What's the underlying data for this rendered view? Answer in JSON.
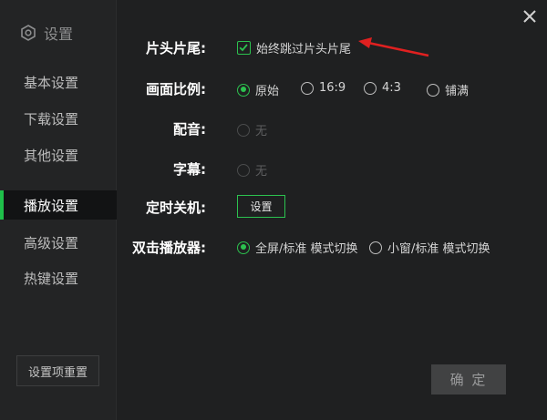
{
  "sidebar": {
    "header": "设置",
    "items": [
      {
        "label": "基本设置"
      },
      {
        "label": "下载设置"
      },
      {
        "label": "其他设置"
      },
      {
        "label": "播放设置"
      },
      {
        "label": "高级设置"
      },
      {
        "label": "热键设置"
      }
    ],
    "active_index": 3,
    "reset_label": "设置项重置"
  },
  "settings": {
    "skip": {
      "label": "片头片尾:",
      "checkbox_label": "始终跳过片头片尾",
      "checked": true
    },
    "aspect": {
      "label": "画面比例:",
      "options": [
        "原始",
        "16:9",
        "4:3",
        "铺满"
      ],
      "selected": "原始"
    },
    "dubbing": {
      "label": "配音:",
      "option": "无"
    },
    "subtitle": {
      "label": "字幕:",
      "option": "无"
    },
    "timer": {
      "label": "定时关机:",
      "button_label": "设置"
    },
    "dblclick": {
      "label": "双击播放器:",
      "options": [
        "全屏/标准 模式切换",
        "小窗/标准 模式切换"
      ],
      "selected": "全屏/标准 模式切换"
    }
  },
  "footer": {
    "confirm_label": "确 定"
  },
  "colors": {
    "accent": "#2cc24f",
    "annotation_arrow": "#e02020",
    "background": "#1f2021"
  }
}
